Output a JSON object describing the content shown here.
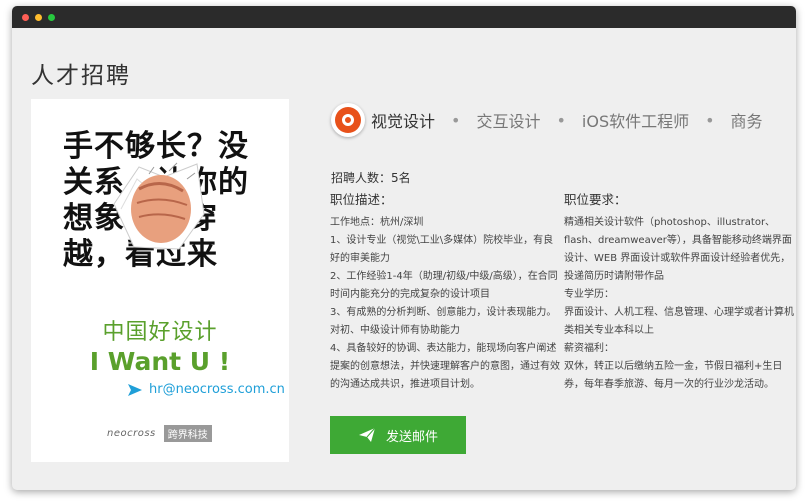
{
  "page": {
    "title": "人才招聘"
  },
  "poster": {
    "headline": "手不够长？没关系，让你的想象点击穿越，看过来",
    "green_title": "中国好设计",
    "tagline": "I Want U !",
    "email": "hr@neocross.com.cn",
    "logo_latin": "neocross",
    "logo_cn": "跨界科技"
  },
  "tabs": [
    {
      "label": "视觉设计",
      "active": true
    },
    {
      "label": "交互设计",
      "active": false
    },
    {
      "label": "iOS软件工程师",
      "active": false
    },
    {
      "label": "商务",
      "active": false
    }
  ],
  "tab_separator": "•",
  "job": {
    "count": "招聘人数：5名",
    "description": {
      "heading": "职位描述：",
      "lines": [
        "工作地点：杭州/深圳",
        "1、设计专业（视觉\\工业\\多媒体）院校毕业，有良好的审美能力",
        "2、工作经验1-4年（助理/初级/中级/高级），在合同时间内能充分的完成复杂的设计项目",
        "3、有成熟的分析判断、创意能力，设计表现能力。对初、中级设计师有协助能力",
        "4、具备较好的协调、表达能力，能现场向客户阐述提案的创意想法，并快速理解客户的意图，通过有效的沟通达成共识，推进项目计划。"
      ]
    },
    "requirements": {
      "heading": "职位要求：",
      "lines": [
        "精通相关设计软件（photoshop、illustrator、flash、dreamweaver等），具备智能移动终端界面设计、WEB 界面设计或软件界面设计经验者优先，投递简历时请附带作品",
        "专业学历：",
        "界面设计、人机工程、信息管理、心理学或者计算机类相关专业本科以上",
        "薪资福利：",
        "双休，转正以后缴纳五险一金，节假日福利+生日券，每年春季旅游、每月一次的行业沙龙活动。"
      ]
    }
  },
  "send_button": {
    "label": "发送邮件"
  },
  "colors": {
    "accent_green": "#3ea935",
    "poster_green": "#5aa02c",
    "tab_icon": "#e8511a",
    "email_blue": "#1f9fd8"
  }
}
